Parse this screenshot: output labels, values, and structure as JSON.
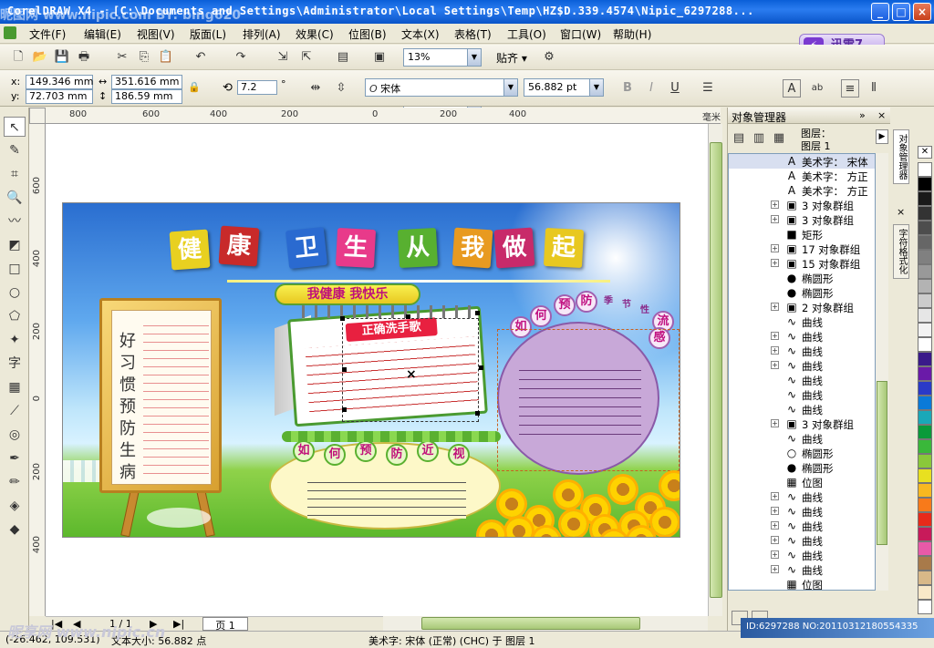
{
  "window": {
    "title": "CorelDRAW X4 - [C:\\Documents and Settings\\Administrator\\Local Settings\\Temp\\HZ$D.339.4574\\Nipic_6297288...",
    "min": "_",
    "max": "□",
    "close": "×"
  },
  "watermarks": {
    "top": "昵图网 www.nipic.com       BY: bing620",
    "bottom": "昵享网 www.nipic.cn",
    "bottom_right": "ID:6297288 NO:20110312180554335"
  },
  "menu": [
    "文件(F)",
    "编辑(E)",
    "视图(V)",
    "版面(L)",
    "排列(A)",
    "效果(C)",
    "位图(B)",
    "文本(X)",
    "表格(T)",
    "工具(O)",
    "窗口(W)",
    "帮助(H)"
  ],
  "xunlei": {
    "label": "迅雷7",
    "icon": "thunder-icon"
  },
  "toolbar": {
    "zoom": "13%",
    "snap": "贴齐"
  },
  "property_bar": {
    "x": "149.346 mm",
    "y": "72.703 mm",
    "w": "351.616 mm",
    "h": "186.59 mm",
    "x_label": "x:",
    "y_label": "y:",
    "angle": "7.2",
    "degree": "°",
    "font": "宋体",
    "font_size": "56.882 pt"
  },
  "rulers": {
    "h_ticks": [
      "800",
      "600",
      "400",
      "200",
      "0",
      "200",
      "400"
    ],
    "h_unit": "毫米",
    "v_ticks": [
      "600",
      "400",
      "200",
      "0",
      "200",
      "400"
    ]
  },
  "poster": {
    "title_chars": [
      {
        "c": "健",
        "bg": "#e8d020"
      },
      {
        "c": "康",
        "bg": "#c82a2a"
      },
      {
        "c": "卫",
        "bg": "#2a6ad0"
      },
      {
        "c": "生",
        "bg": "#e83a8a"
      },
      {
        "c": "从",
        "bg": "#58b030"
      },
      {
        "c": "我",
        "bg": "#e89a20"
      },
      {
        "c": "做",
        "bg": "#c82a6a"
      },
      {
        "c": "起",
        "bg": "#e8c820"
      }
    ],
    "subtitle": "我健康 我快乐",
    "board_text": "好习惯预防生病",
    "calendar_title": "正确洗手歌",
    "circle_chars": [
      "如",
      "何",
      "预",
      "防",
      "季",
      "节",
      "性",
      "流",
      "感"
    ],
    "ellipse_chars": [
      "如",
      "何",
      "预",
      "防",
      "近",
      "视"
    ]
  },
  "docker": {
    "title": "对象管理器",
    "layer_label": "图层：",
    "layer_name": "图层 1",
    "rows": [
      {
        "icon": "A",
        "label": "美术字： 宋体",
        "sel": true,
        "ex": false
      },
      {
        "icon": "A",
        "label": "美术字： 方正",
        "sel": false,
        "ex": false
      },
      {
        "icon": "A",
        "label": "美术字： 方正",
        "sel": false,
        "ex": false
      },
      {
        "icon": "▣",
        "label": "3 对象群组",
        "sel": false,
        "ex": true
      },
      {
        "icon": "▣",
        "label": "3 对象群组",
        "sel": false,
        "ex": true
      },
      {
        "icon": "■",
        "label": "矩形",
        "sel": false,
        "ex": false
      },
      {
        "icon": "▣",
        "label": "17 对象群组",
        "sel": false,
        "ex": true
      },
      {
        "icon": "▣",
        "label": "15 对象群组",
        "sel": false,
        "ex": true
      },
      {
        "icon": "●",
        "label": "椭圆形",
        "sel": false,
        "ex": false
      },
      {
        "icon": "●",
        "label": "椭圆形",
        "sel": false,
        "ex": false
      },
      {
        "icon": "▣",
        "label": "2 对象群组",
        "sel": false,
        "ex": true
      },
      {
        "icon": "∿",
        "label": "曲线",
        "sel": false,
        "ex": false
      },
      {
        "icon": "∿",
        "label": "曲线",
        "sel": false,
        "ex": true
      },
      {
        "icon": "∿",
        "label": "曲线",
        "sel": false,
        "ex": true
      },
      {
        "icon": "∿",
        "label": "曲线",
        "sel": false,
        "ex": true
      },
      {
        "icon": "∿",
        "label": "曲线",
        "sel": false,
        "ex": false
      },
      {
        "icon": "∿",
        "label": "曲线",
        "sel": false,
        "ex": false
      },
      {
        "icon": "∿",
        "label": "曲线",
        "sel": false,
        "ex": false
      },
      {
        "icon": "▣",
        "label": "3 对象群组",
        "sel": false,
        "ex": true
      },
      {
        "icon": "∿",
        "label": "曲线",
        "sel": false,
        "ex": false
      },
      {
        "icon": "○",
        "label": "椭圆形",
        "sel": false,
        "ex": false
      },
      {
        "icon": "●",
        "label": "椭圆形",
        "sel": false,
        "ex": false
      },
      {
        "icon": "▦",
        "label": "位图",
        "sel": false,
        "ex": false
      },
      {
        "icon": "∿",
        "label": "曲线",
        "sel": false,
        "ex": true
      },
      {
        "icon": "∿",
        "label": "曲线",
        "sel": false,
        "ex": true
      },
      {
        "icon": "∿",
        "label": "曲线",
        "sel": false,
        "ex": true
      },
      {
        "icon": "∿",
        "label": "曲线",
        "sel": false,
        "ex": true
      },
      {
        "icon": "∿",
        "label": "曲线",
        "sel": false,
        "ex": true
      },
      {
        "icon": "∿",
        "label": "曲线",
        "sel": false,
        "ex": true
      },
      {
        "icon": "▦",
        "label": "位图",
        "sel": false,
        "ex": false
      }
    ],
    "tab1": "对象管理器",
    "tab2": "字符格式化"
  },
  "page_nav": {
    "page_count": "1 / 1",
    "page_tab": "页 1"
  },
  "status": {
    "coords": "(-26.462, 109.531)",
    "text_size": "文本大小: 56.882 点",
    "object": "美术字: 宋体 (正常) (CHC) 于 图层 1"
  },
  "palette": [
    "#ffffff",
    "#000000",
    "#1a1a1a",
    "#333333",
    "#4d4d4d",
    "#666666",
    "#808080",
    "#999999",
    "#b3b3b3",
    "#cccccc",
    "#e6e6e6",
    "#f2f2f2",
    "#ffffff",
    "#3a1a8a",
    "#6a1aa8",
    "#2a3ac8",
    "#0a7ad8",
    "#1aa8b8",
    "#0a9a3a",
    "#3ab83a",
    "#8ac83a",
    "#e8e020",
    "#f8b820",
    "#f87a1a",
    "#e82a1a",
    "#c81a5a",
    "#e85aa8",
    "#a87a4a",
    "#d8b888",
    "#f8e8c8",
    "#ffffff"
  ]
}
